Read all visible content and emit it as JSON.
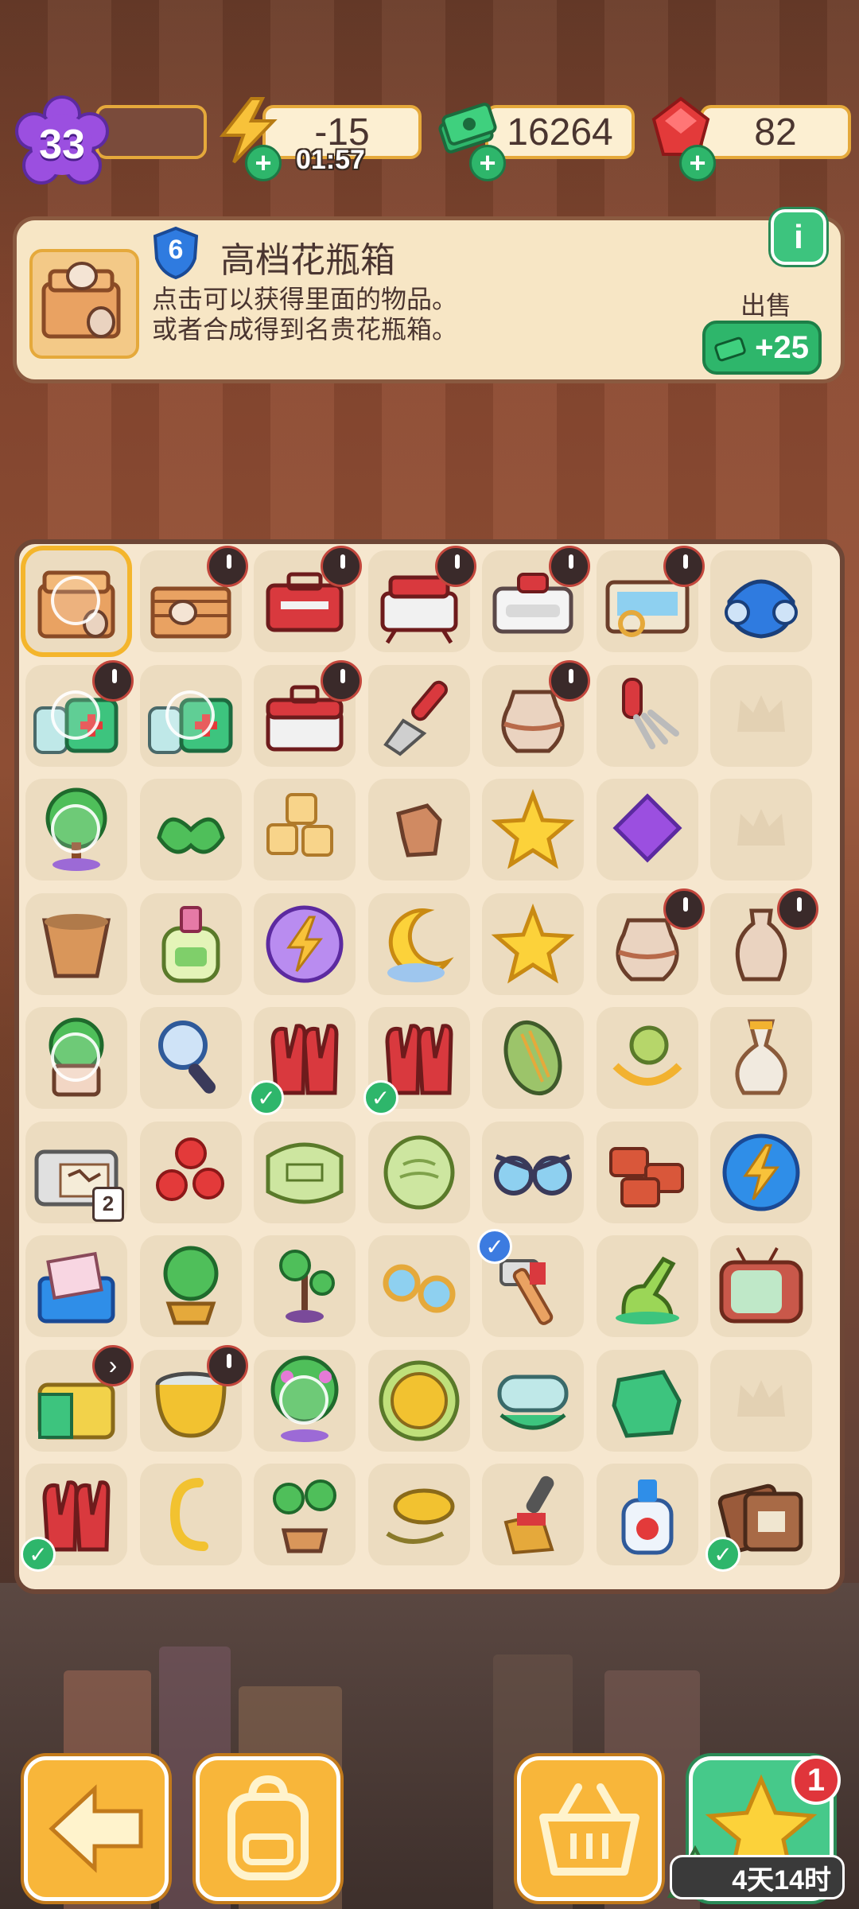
{
  "topbar": {
    "level": "33",
    "energy": "-15",
    "energy_timer": "01:57",
    "cash": "16264",
    "gems": "82"
  },
  "info_panel": {
    "item_level": "6",
    "title": "高档花瓶箱",
    "description_line1": "点击可以获得里面的物品。",
    "description_line2": "或者合成得到名贵花瓶箱。",
    "sell_label": "出售",
    "sell_value": "+25",
    "info_button": "i"
  },
  "board": {
    "rows": [
      [
        "vase-crate",
        "wooden-crate",
        "red-toolbox",
        "red-toolbox-open",
        "white-toolbox",
        "archaeology-kit",
        "respirator-mask"
      ],
      [
        "first-aid-bottles",
        "first-aid-bottles",
        "red-case",
        "trowel",
        "clay-pot",
        "hand-rake",
        "empty"
      ],
      [
        "magic-tree",
        "green-leaf",
        "sugar-cubes",
        "pottery-shard",
        "star",
        "purple-gem",
        "empty"
      ],
      [
        "flower-pot",
        "lotion-bottle",
        "energy-orb",
        "moon-cloud",
        "star",
        "clay-pot",
        "vase"
      ],
      [
        "potted-plant",
        "magnifier",
        "red-gloves",
        "red-gloves",
        "woven-mat",
        "yellow-clasp",
        "gold-vase"
      ],
      [
        "map-printer",
        "red-gems",
        "stone-tablet",
        "melon-slice",
        "sunglasses",
        "red-bricks",
        "energy-coin"
      ],
      [
        "letter-envelope",
        "bonsai",
        "small-sprout",
        "gold-glasses",
        "hammer-tool",
        "green-vacuum",
        "retro-tv"
      ],
      [
        "green-bag",
        "cauldron",
        "magic-tree-large",
        "elephant-coin",
        "goggles",
        "green-cloth",
        "empty"
      ],
      [
        "red-gloves",
        "gold-hook",
        "sapling",
        "gold-lid",
        "brush",
        "spray-bottle",
        "leather-wallet"
      ]
    ],
    "item_2_tag": "2"
  },
  "bottom": {
    "notification_count": "1",
    "event_timer": "4天14时"
  },
  "colors": {
    "accent_orange": "#f8b63a",
    "accent_green": "#2eb66b",
    "panel_bg": "#f7e6c5",
    "board_bg": "#f6e7cf"
  }
}
